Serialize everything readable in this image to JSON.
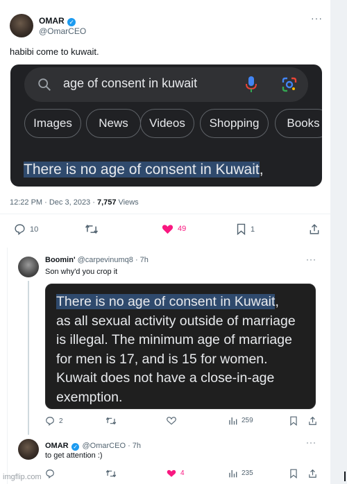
{
  "tweet1": {
    "author_name": "OMAR",
    "author_handle": "@OmarCEO",
    "more_glyph": "···",
    "text": "habibi come to kuwait.",
    "screenshot": {
      "search_query": "age of consent in kuwait",
      "chips": [
        "Images",
        "News",
        "Videos",
        "Shopping",
        "Books"
      ],
      "highlight_text": "There is no age of consent in Kuwait",
      "highlight_suffix": ","
    },
    "timestamp": "12:22 PM · Dec 3, 2023 · ",
    "views_count": "7,757",
    "views_label": " Views",
    "actions": {
      "replies": "10",
      "likes": "49",
      "bookmarks": "1"
    },
    "colors": {
      "like": "#f91880",
      "google_blue": "#4285f4",
      "google_red": "#ea4335"
    }
  },
  "reply1": {
    "author_name": "Boomin'",
    "author_handle": "@carpevinumq8 · 7h",
    "more_glyph": "···",
    "text": "Son why'd you crop it",
    "quote_lines": [
      "There is no age of consent in Kuwait",
      "as all sexual activity outside of marriage",
      "is illegal. The minimum age of marriage",
      "for men is 17, and is 15 for women.",
      "Kuwait does not have a close-in-age",
      "exemption."
    ],
    "quote_line1_suffix": ",",
    "actions": {
      "replies": "2",
      "views": "259"
    }
  },
  "reply2": {
    "author_name": "OMAR",
    "author_handle": "@OmarCEO · 7h",
    "more_glyph": "···",
    "text": "to get attention :)",
    "actions": {
      "likes": "4",
      "views": "235"
    }
  },
  "watermark": "imgflip.com"
}
